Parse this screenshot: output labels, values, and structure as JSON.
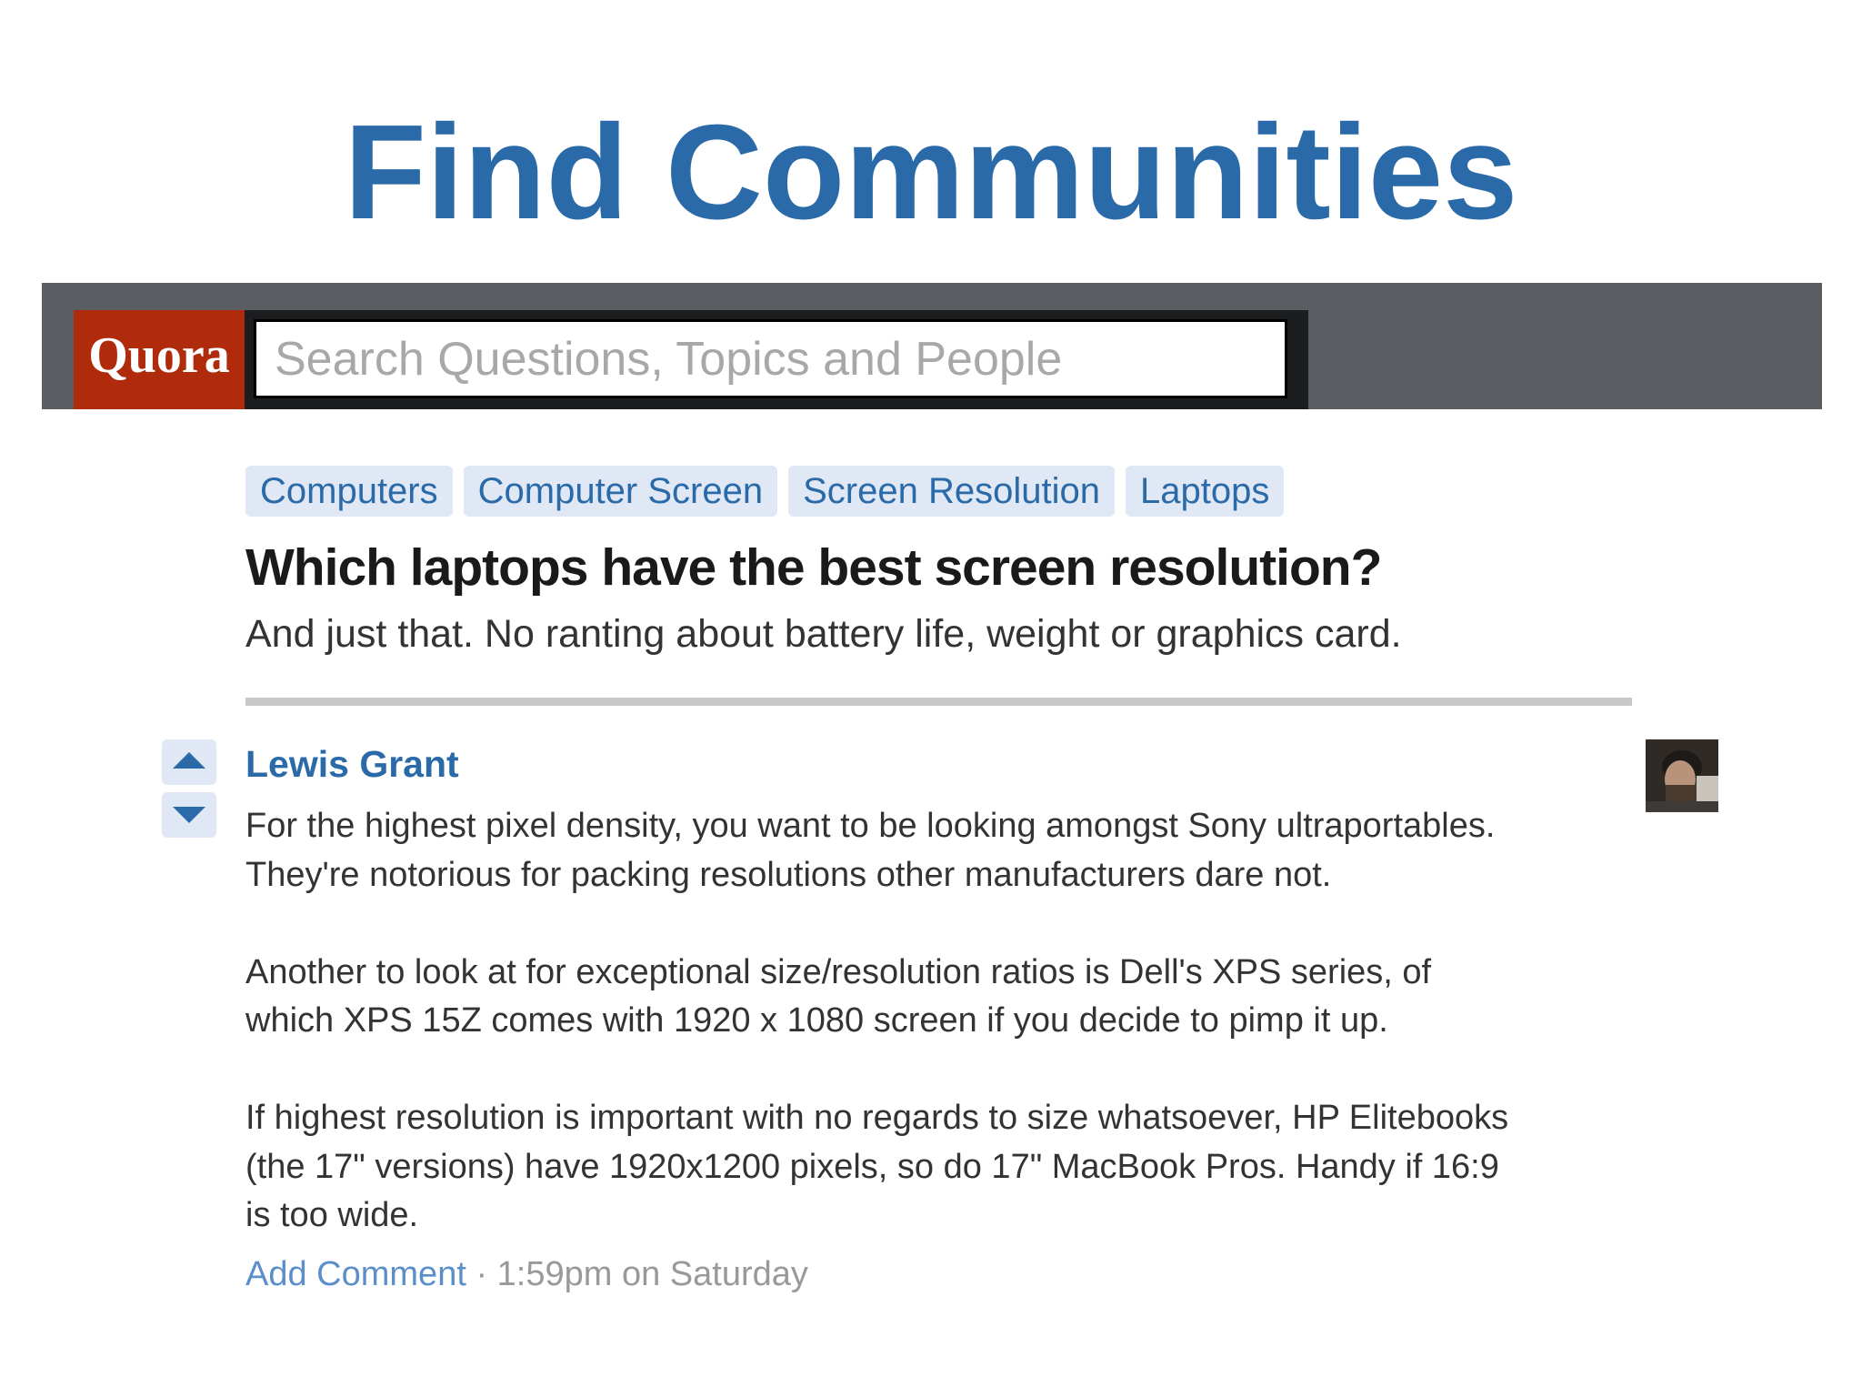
{
  "slide": {
    "title": "Find Communities"
  },
  "header": {
    "logo_text": "Quora",
    "search_placeholder": "Search Questions, Topics and People"
  },
  "question": {
    "tags": [
      {
        "label": "Computers"
      },
      {
        "label": "Computer Screen"
      },
      {
        "label": "Screen Resolution"
      },
      {
        "label": "Laptops"
      }
    ],
    "title": "Which laptops have the best screen resolution?",
    "details": "And just that. No ranting about battery life, weight or graphics card."
  },
  "answer": {
    "author": "Lewis Grant",
    "paragraphs": [
      "For the highest pixel density, you want to be looking amongst Sony ultraportables.\nThey're notorious for packing resolutions other manufacturers dare not.",
      "Another to look at for exceptional size/resolution ratios is Dell's XPS series, of\nwhich XPS 15Z comes with 1920 x 1080 screen if you decide to pimp it up.",
      "If highest resolution is important with no regards to size whatsoever, HP Elitebooks\n(the 17\" versions) have 1920x1200 pixels, so do 17\" MacBook Pros. Handy if 16:9\nis too wide."
    ],
    "add_comment_label": "Add Comment",
    "separator": " · ",
    "timestamp": "1:59pm on Saturday"
  },
  "icons": {
    "upvote": "triangle-up-icon",
    "downvote": "triangle-down-icon",
    "avatar": "user-avatar-photo"
  },
  "colors": {
    "title_blue": "#2a6aa8",
    "quora_red": "#b02b0c",
    "topbar_gray": "#5a5d62",
    "tag_background": "#dfe8f4",
    "link_blue": "#2a6aa8"
  }
}
